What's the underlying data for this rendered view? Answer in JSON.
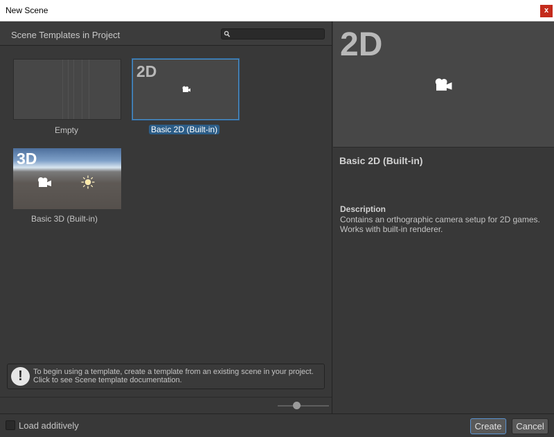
{
  "window": {
    "title": "New Scene",
    "close_label": "x"
  },
  "left": {
    "header_title": "Scene Templates in Project",
    "search": {
      "value": "",
      "placeholder": ""
    },
    "templates": [
      {
        "label": "Empty",
        "thumb_text": "",
        "selected": false
      },
      {
        "label": "Basic 2D (Built-in)",
        "thumb_text": "2D",
        "selected": true
      },
      {
        "label": "Basic 3D (Built-in)",
        "thumb_text": "3D",
        "selected": false
      }
    ],
    "info": {
      "icon": "exclamation-icon",
      "line1": "To begin using a template, create a template from an existing scene in your project.",
      "line2": "Click to see Scene template documentation."
    },
    "zoom_slider": {
      "value": 0.35
    }
  },
  "right": {
    "preview_text": "2D",
    "title": "Basic 2D (Built-in)",
    "description_heading": "Description",
    "description": "Contains an orthographic camera setup for 2D games. Works with built-in renderer."
  },
  "footer": {
    "load_additively_label": "Load additively",
    "load_additively_checked": false,
    "create_label": "Create",
    "cancel_label": "Cancel"
  },
  "colors": {
    "accent": "#2c5d87",
    "selection_border": "#4a8fc8",
    "close": "#c42b1c"
  }
}
